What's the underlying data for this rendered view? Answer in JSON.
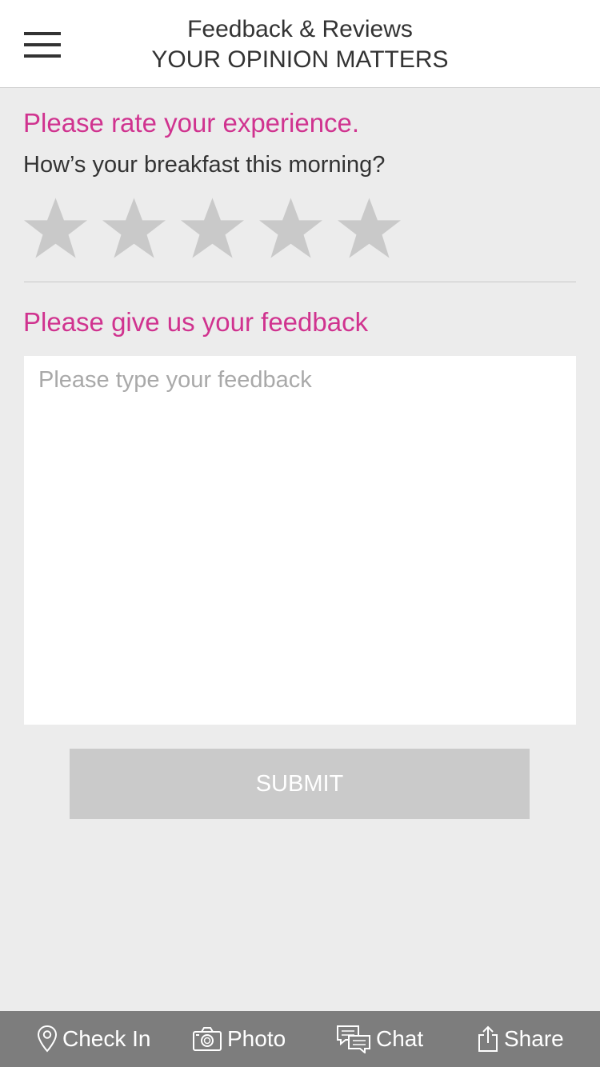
{
  "header": {
    "title": "Feedback & Reviews",
    "subtitle": "YOUR OPINION MATTERS"
  },
  "rating": {
    "heading": "Please rate your experience.",
    "question": "How’s your breakfast this morning?",
    "max_stars": 5,
    "selected_stars": 0,
    "star_color": "#c9c9c9"
  },
  "feedback": {
    "heading": "Please give us your feedback",
    "placeholder": "Please type your feedback",
    "value": ""
  },
  "submit": {
    "label": "SUBMIT"
  },
  "tabbar": {
    "items": [
      {
        "label": "Check In",
        "icon": "location-pin-icon"
      },
      {
        "label": "Photo",
        "icon": "camera-icon"
      },
      {
        "label": "Chat",
        "icon": "chat-bubbles-icon"
      },
      {
        "label": "Share",
        "icon": "share-icon"
      }
    ]
  },
  "colors": {
    "accent": "#d0338f",
    "background": "#ececec",
    "tabbar": "#7d7d7d",
    "button": "#cacaca"
  }
}
